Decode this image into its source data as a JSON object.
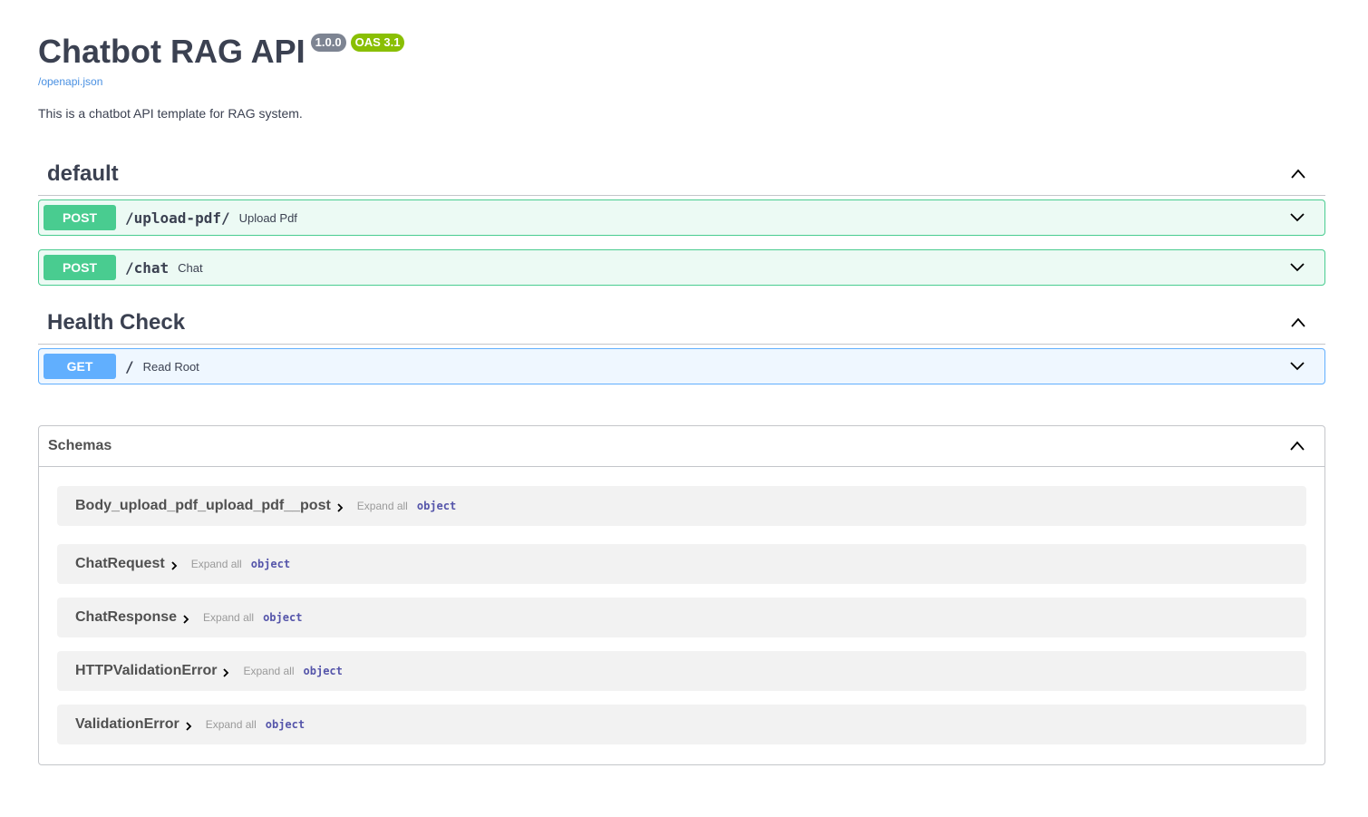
{
  "info": {
    "title": "Chatbot RAG API",
    "version": "1.0.0",
    "oas_version": "OAS 3.1",
    "spec_link": "/openapi.json",
    "description": "This is a chatbot API template for RAG system."
  },
  "tags": [
    {
      "name": "default",
      "operations": [
        {
          "method": "POST",
          "path": "/upload-pdf/",
          "summary": "Upload Pdf"
        },
        {
          "method": "POST",
          "path": "/chat",
          "summary": "Chat"
        }
      ]
    },
    {
      "name": "Health Check",
      "operations": [
        {
          "method": "GET",
          "path": "/",
          "summary": "Read Root"
        }
      ]
    }
  ],
  "schemas": {
    "title": "Schemas",
    "expand_label": "Expand all",
    "items": [
      {
        "name": "Body_upload_pdf_upload_pdf__post",
        "type": "object"
      },
      {
        "name": "ChatRequest",
        "type": "object"
      },
      {
        "name": "ChatResponse",
        "type": "object"
      },
      {
        "name": "HTTPValidationError",
        "type": "object"
      },
      {
        "name": "ValidationError",
        "type": "object"
      }
    ]
  },
  "colors": {
    "post": "#49cc90",
    "get": "#61affe",
    "oas_badge": "#89bf04",
    "version_badge": "#7d8492"
  },
  "icons": {
    "section_toggle": "chevron-up-icon",
    "operation_toggle": "chevron-down-icon",
    "model_toggle": "chevron-right-icon"
  }
}
